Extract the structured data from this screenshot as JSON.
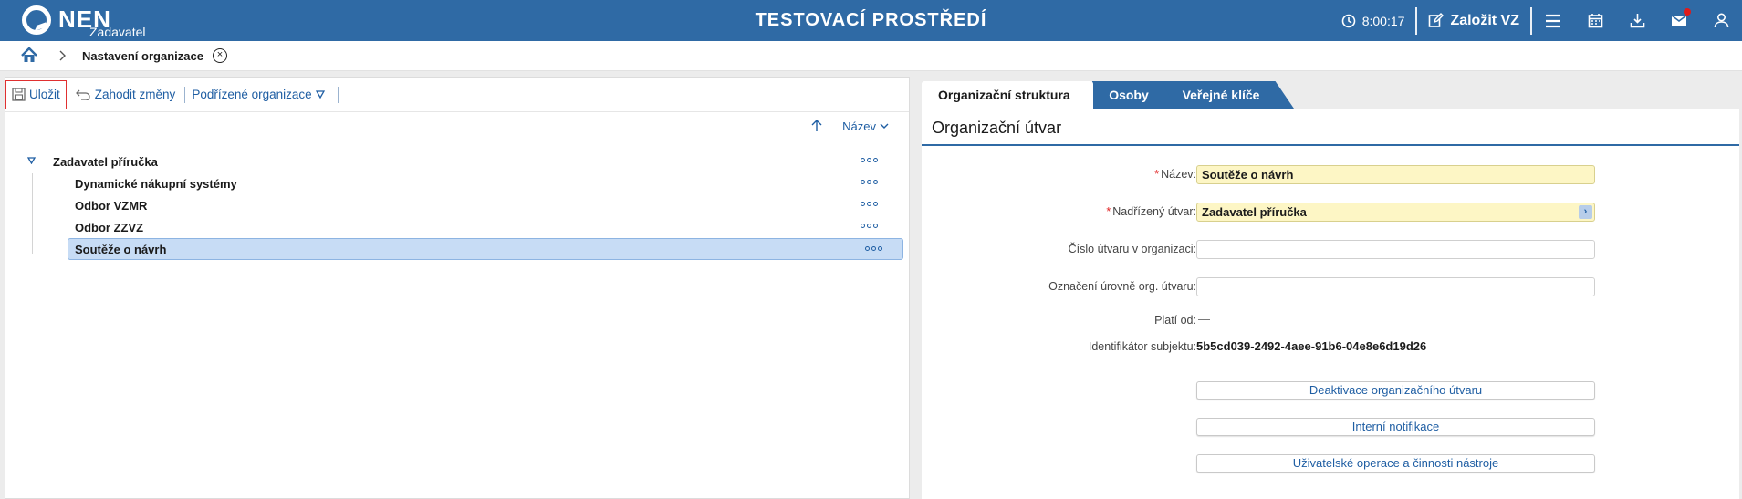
{
  "app": {
    "logo_text": "NEN",
    "logo_sub": "Zadavatel",
    "env_title": "TESTOVACÍ PROSTŘEDÍ",
    "time": "8:00:17",
    "create_vz_label": "Založit VZ",
    "icons": [
      "clock-icon",
      "edit-icon",
      "menu-icon",
      "calendar-icon",
      "download-icon",
      "mail-icon",
      "user-icon"
    ]
  },
  "breadcrumb": {
    "current": "Nastavení organizace",
    "close_symbol": "×"
  },
  "toolbar": {
    "save_label": "Uložit",
    "discard_label": "Zahodit změny",
    "sub_org_label": "Podřízené organizace"
  },
  "sort": {
    "label": "Název"
  },
  "tree": {
    "root": "Zadavatel příručka",
    "children": [
      {
        "label": "Dynamické nákupní systémy"
      },
      {
        "label": "Odbor VZMR"
      },
      {
        "label": "Odbor ZZVZ"
      },
      {
        "label": "Soutěže o návrh",
        "selected": true
      }
    ]
  },
  "tabs": {
    "active": "Organizační struktura",
    "osoby": "Osoby",
    "klice": "Veřejné klíče"
  },
  "form": {
    "title": "Organizační útvar",
    "required_mark": "*",
    "nazev_label": "Název:",
    "nazev_value": "Soutěže o návrh",
    "nadrizeny_label": "Nadřízený útvar:",
    "nadrizeny_value": "Zadavatel příručka",
    "cislo_label": "Číslo útvaru v organizaci:",
    "cislo_value": "",
    "oznaceni_label": "Označení úrovně org. útvaru:",
    "oznaceni_value": "",
    "plati_label": "Platí od:",
    "plati_value": "—",
    "ident_label": "Identifikátor subjektu:",
    "ident_value": "5b5cd039-2492-4aee-91b6-04e8e6d19d26",
    "btn_deaktivace": "Deaktivace organizačního útvaru",
    "btn_notifikace": "Interní notifikace",
    "btn_operace": "Uživatelské operace a činnosti nástroje"
  },
  "colors": {
    "brand": "#2f6aa5",
    "link": "#1f5ea3",
    "required": "#e02020",
    "selected_row": "#c7dcf5",
    "required_field": "#fdf6c5"
  }
}
